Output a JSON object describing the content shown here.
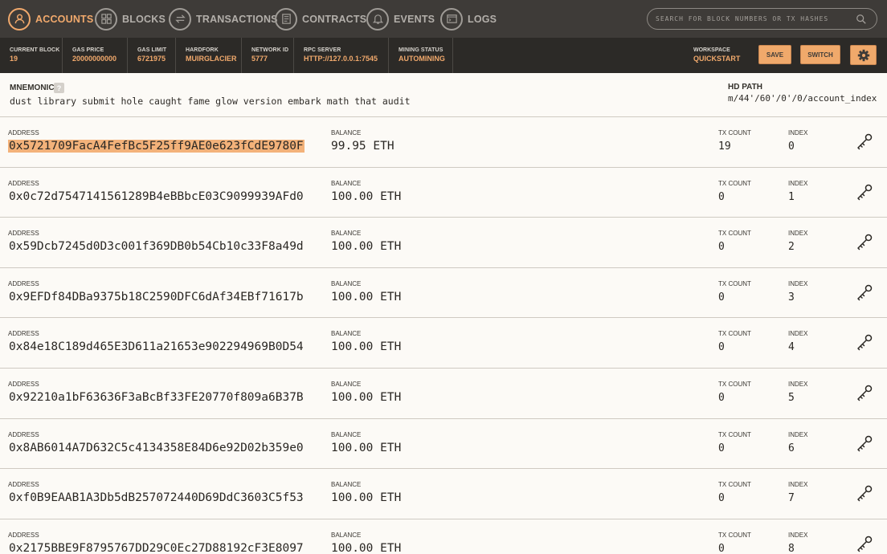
{
  "nav": {
    "items": [
      {
        "label": "ACCOUNTS",
        "icon": "accounts-icon"
      },
      {
        "label": "BLOCKS",
        "icon": "blocks-icon"
      },
      {
        "label": "TRANSACTIONS",
        "icon": "transactions-icon"
      },
      {
        "label": "CONTRACTS",
        "icon": "contracts-icon"
      },
      {
        "label": "EVENTS",
        "icon": "events-icon"
      },
      {
        "label": "LOGS",
        "icon": "logs-icon"
      }
    ],
    "active": "ACCOUNTS",
    "search_placeholder": "SEARCH FOR BLOCK NUMBERS OR TX HASHES"
  },
  "status": {
    "current_block": {
      "label": "CURRENT BLOCK",
      "value": "19"
    },
    "gas_price": {
      "label": "GAS PRICE",
      "value": "20000000000"
    },
    "gas_limit": {
      "label": "GAS LIMIT",
      "value": "6721975"
    },
    "hardfork": {
      "label": "HARDFORK",
      "value": "MUIRGLACIER"
    },
    "network_id": {
      "label": "NETWORK ID",
      "value": "5777"
    },
    "rpc_server": {
      "label": "RPC SERVER",
      "value": "HTTP://127.0.0.1:7545"
    },
    "mining_status": {
      "label": "MINING STATUS",
      "value": "AUTOMINING"
    },
    "workspace": {
      "label": "WORKSPACE",
      "value": "QUICKSTART"
    }
  },
  "buttons": {
    "save": "SAVE",
    "switch": "SWITCH"
  },
  "mnemonic": {
    "label": "MNEMONIC",
    "help": "?",
    "value": "dust library submit hole caught fame glow version embark math that audit",
    "hd_path_label": "HD PATH",
    "hd_path_value": "m/44'/60'/0'/0/account_index"
  },
  "labels": {
    "address": "ADDRESS",
    "balance": "BALANCE",
    "tx_count": "TX COUNT",
    "index": "INDEX"
  },
  "accounts": [
    {
      "address": "0x5721709FacA4FefBc5F25ff9AE0e623fCdE9780F",
      "balance": "99.95 ETH",
      "tx_count": "19",
      "index": "0"
    },
    {
      "address": "0x0c72d7547141561289B4eBBbcE03C9099939AFd0",
      "balance": "100.00 ETH",
      "tx_count": "0",
      "index": "1"
    },
    {
      "address": "0x59Dcb7245d0D3c001f369DB0b54Cb10c33F8a49d",
      "balance": "100.00 ETH",
      "tx_count": "0",
      "index": "2"
    },
    {
      "address": "0x9EFDf84DBa9375b18C2590DFC6dAf34EBf71617b",
      "balance": "100.00 ETH",
      "tx_count": "0",
      "index": "3"
    },
    {
      "address": "0x84e18C189d465E3D611a21653e902294969B0D54",
      "balance": "100.00 ETH",
      "tx_count": "0",
      "index": "4"
    },
    {
      "address": "0x92210a1bF63636F3aBcBf33FE20770f809a6B37B",
      "balance": "100.00 ETH",
      "tx_count": "0",
      "index": "5"
    },
    {
      "address": "0x8AB6014A7D632C5c4134358E84D6e92D02b359e0",
      "balance": "100.00 ETH",
      "tx_count": "0",
      "index": "6"
    },
    {
      "address": "0xf0B9EAAB1A3Db5dB257072440D69DdC3603C5f53",
      "balance": "100.00 ETH",
      "tx_count": "0",
      "index": "7"
    },
    {
      "address": "0x2175BBE9F8795767DD29C0Ec27D88192cF3E8097",
      "balance": "100.00 ETH",
      "tx_count": "0",
      "index": "8"
    }
  ],
  "colors": {
    "accent": "#f1a96c",
    "nav_bg": "#3e3b38",
    "status_bg": "#2c2a27",
    "page_bg": "#fcfaf6",
    "selected": "#f3b27a"
  }
}
